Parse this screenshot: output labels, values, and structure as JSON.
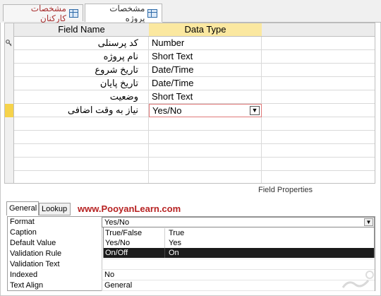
{
  "tabs": [
    {
      "label": "مشخصات کارکنان",
      "active": false
    },
    {
      "label": "مشخصات پروژه",
      "active": true
    }
  ],
  "grid": {
    "header_field": "Field Name",
    "header_type": "Data Type",
    "rows": [
      {
        "name": "کد پرسنلی",
        "type": "Number"
      },
      {
        "name": "نام پروژه",
        "type": "Short Text"
      },
      {
        "name": "تاریخ شروع",
        "type": "Date/Time"
      },
      {
        "name": "تاریخ پایان",
        "type": "Date/Time"
      },
      {
        "name": "وضعیت",
        "type": "Short Text"
      },
      {
        "name": "نیاز به وقت اضافی",
        "type": "Yes/No"
      }
    ]
  },
  "field_properties_label": "Field Properties",
  "prop_tabs": {
    "general": "General",
    "lookup": "Lookup"
  },
  "brand": "www.PooyanLearn.com",
  "props": {
    "format": {
      "label": "Format",
      "value": "Yes/No"
    },
    "caption": {
      "label": "Caption"
    },
    "default_value": {
      "label": "Default Value"
    },
    "validation_rule": {
      "label": "Validation Rule"
    },
    "validation_text": {
      "label": "Validation Text"
    },
    "indexed": {
      "label": "Indexed",
      "value": "No"
    },
    "text_align": {
      "label": "Text Align",
      "value": "General"
    }
  },
  "format_options": [
    {
      "name": "True/False",
      "value": "True"
    },
    {
      "name": "Yes/No",
      "value": "Yes"
    },
    {
      "name": "On/Off",
      "value": "On"
    }
  ],
  "colors": {
    "accent_header": "#fbe8a0",
    "row_selector": "#f6d34b",
    "brand": "#b72222"
  },
  "icons": [
    "table-icon",
    "primary-key-icon",
    "dropdown-arrow-icon"
  ]
}
